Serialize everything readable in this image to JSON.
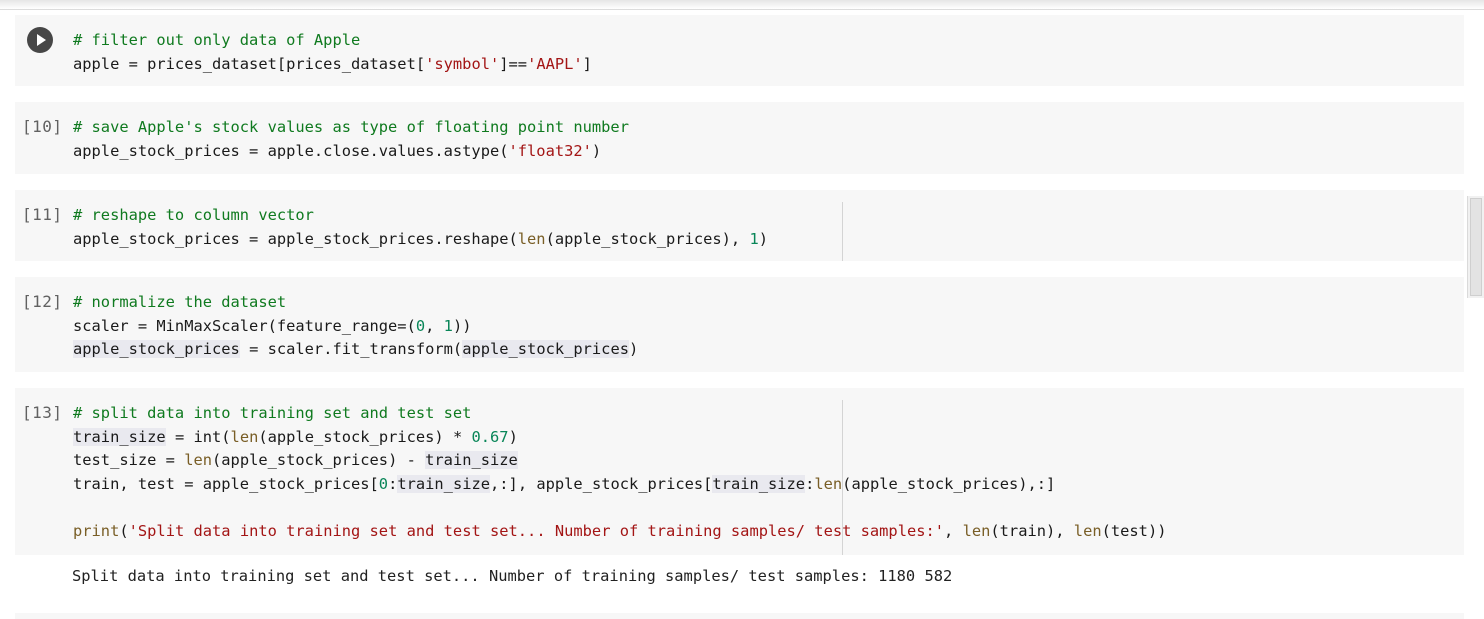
{
  "cells": [
    {
      "prompt": "",
      "lines": [
        [
          {
            "t": "# filter out only data of Apple",
            "c": "cmt"
          }
        ],
        [
          {
            "t": "apple = prices_dataset[prices_dataset["
          },
          {
            "t": "'symbol'",
            "c": "str"
          },
          {
            "t": "]=="
          },
          {
            "t": "'AAPL'",
            "c": "str"
          },
          {
            "t": "]"
          }
        ]
      ]
    },
    {
      "prompt": "[10]",
      "lines": [
        [
          {
            "t": "# save Apple's stock values as type of floating point number",
            "c": "cmt"
          }
        ],
        [
          {
            "t": "apple_stock_prices = apple.close.values.astype("
          },
          {
            "t": "'float32'",
            "c": "str"
          },
          {
            "t": ")"
          }
        ]
      ]
    },
    {
      "prompt": "[11]",
      "lines": [
        [
          {
            "t": "# reshape to column vector",
            "c": "cmt"
          }
        ],
        [
          {
            "t": "apple_stock_prices = apple_stock_prices.reshape("
          },
          {
            "t": "len",
            "c": "fn"
          },
          {
            "t": "(apple_stock_prices), "
          },
          {
            "t": "1",
            "c": "num"
          },
          {
            "t": ")"
          }
        ]
      ]
    },
    {
      "prompt": "[12]",
      "lines": [
        [
          {
            "t": "# normalize the dataset",
            "c": "cmt"
          }
        ],
        [
          {
            "t": "scaler = MinMaxScaler(feature_range=("
          },
          {
            "t": "0",
            "c": "num"
          },
          {
            "t": ", "
          },
          {
            "t": "1",
            "c": "num"
          },
          {
            "t": "))"
          }
        ],
        [
          {
            "t": "apple_stock_prices",
            "c": "hl"
          },
          {
            "t": " = scaler.fit_transform("
          },
          {
            "t": "apple_stock_prices",
            "c": "hl"
          },
          {
            "t": ")"
          }
        ]
      ]
    },
    {
      "prompt": "[13]",
      "lines": [
        [
          {
            "t": "# split data into training set and test set",
            "c": "cmt"
          }
        ],
        [
          {
            "t": "train_size",
            "c": "hl"
          },
          {
            "t": " = int("
          },
          {
            "t": "len",
            "c": "fn"
          },
          {
            "t": "(apple_stock_prices) * "
          },
          {
            "t": "0.67",
            "c": "num"
          },
          {
            "t": ")"
          }
        ],
        [
          {
            "t": "test_size = "
          },
          {
            "t": "len",
            "c": "fn"
          },
          {
            "t": "(apple_stock_prices) - "
          },
          {
            "t": "train_size",
            "c": "hl"
          }
        ],
        [
          {
            "t": "train, test = apple_stock_prices["
          },
          {
            "t": "0",
            "c": "num"
          },
          {
            "t": ":"
          },
          {
            "t": "train_size",
            "c": "hl"
          },
          {
            "t": ",:], apple_stock_prices["
          },
          {
            "t": "train_size",
            "c": "hl"
          },
          {
            "t": ":"
          },
          {
            "t": "len",
            "c": "fn"
          },
          {
            "t": "(apple_stock_prices),:]"
          }
        ],
        [],
        [
          {
            "t": "print",
            "c": "fn"
          },
          {
            "t": "("
          },
          {
            "t": "'Split data into training set and test set... Number of training samples/ test samples:'",
            "c": "str"
          },
          {
            "t": ", "
          },
          {
            "t": "len",
            "c": "fn"
          },
          {
            "t": "(train), "
          },
          {
            "t": "len",
            "c": "fn"
          },
          {
            "t": "(test))"
          }
        ]
      ]
    }
  ],
  "output": "Split data into training set and test set... Number of training samples/ test samples: 1180 582"
}
